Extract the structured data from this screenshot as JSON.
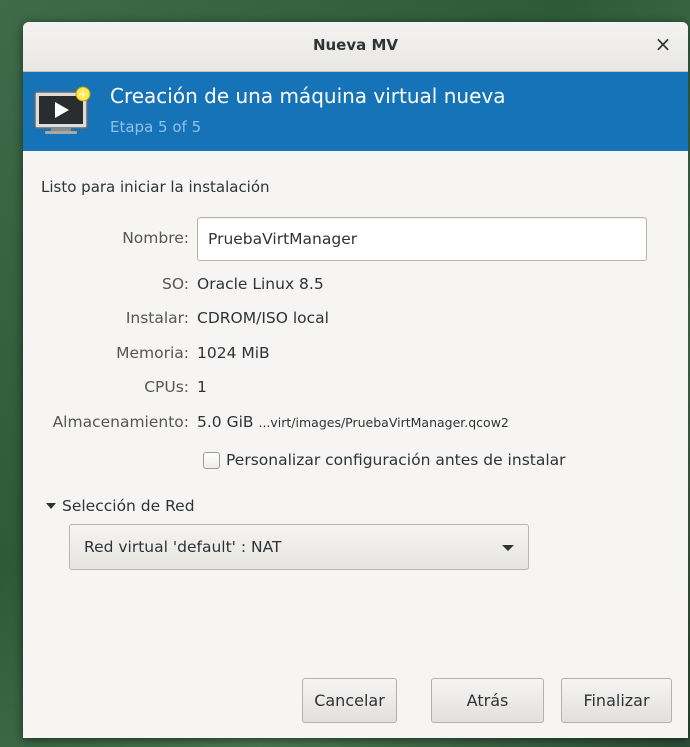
{
  "window": {
    "title": "Nueva MV",
    "close_glyph": "×"
  },
  "banner": {
    "heading": "Creación de una máquina virtual nueva",
    "step": "Etapa 5 of 5",
    "icon": "vm-monitor-icon",
    "color": "#1773b8"
  },
  "summary": {
    "intro": "Listo para iniciar la instalación",
    "name_label": "Nombre:",
    "name_value": "PruebaVirtManager",
    "os_label": "SO:",
    "os_value": "Oracle Linux 8.5",
    "install_label": "Instalar:",
    "install_value": "CDROM/ISO local",
    "memory_label": "Memoria:",
    "memory_value": "1024 MiB",
    "cpus_label": "CPUs:",
    "cpus_value": "1",
    "storage_label": "Almacenamiento:",
    "storage_size": "5.0 GiB",
    "storage_path": "...virt/images/PruebaVirtManager.qcow2",
    "customize_label": "Personalizar configuración antes de instalar",
    "customize_checked": false
  },
  "network": {
    "expander_label": "Selección de Red",
    "selected": "Red virtual 'default' : NAT"
  },
  "buttons": {
    "cancel": "Cancelar",
    "back": "Atrás",
    "finish": "Finalizar"
  }
}
